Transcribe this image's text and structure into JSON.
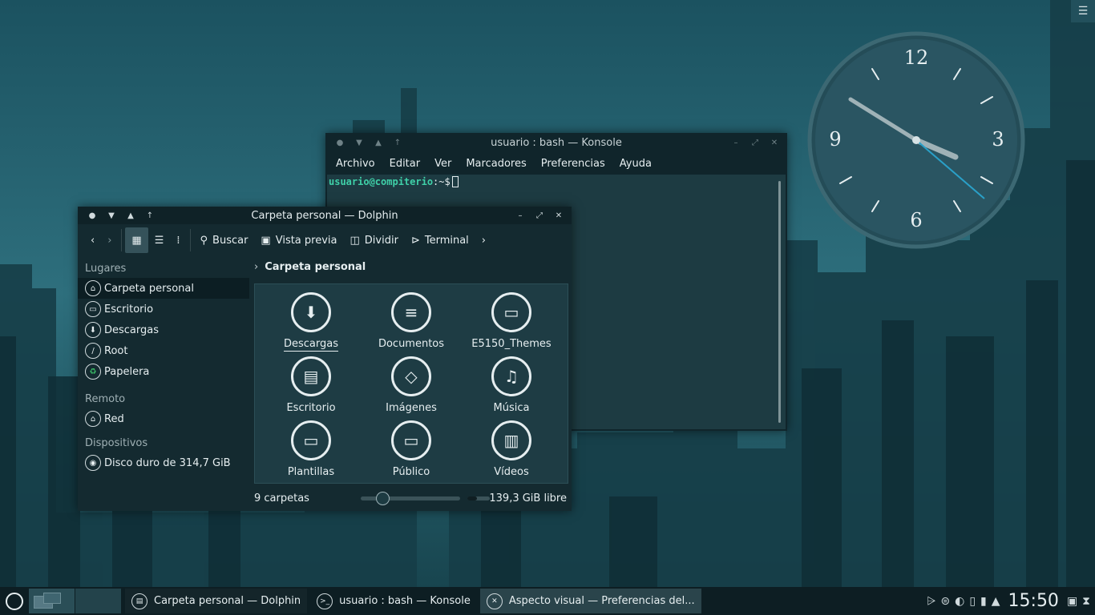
{
  "clock": {
    "n12": "12",
    "n3": "3",
    "n6": "6",
    "n9": "9"
  },
  "konsole": {
    "title": "usuario : bash — Konsole",
    "menu": [
      "Archivo",
      "Editar",
      "Ver",
      "Marcadores",
      "Preferencias",
      "Ayuda"
    ],
    "prompt_user": "usuario@compiterio",
    "prompt_path": ":~$"
  },
  "dolphin": {
    "title": "Carpeta personal — Dolphin",
    "toolbar": {
      "search": "Buscar",
      "preview": "Vista previa",
      "split": "Dividir",
      "terminal": "Terminal"
    },
    "sidebar": {
      "places_header": "Lugares",
      "places": [
        "Carpeta personal",
        "Escritorio",
        "Descargas",
        "Root",
        "Papelera"
      ],
      "remote_header": "Remoto",
      "remote": [
        "Red"
      ],
      "devices_header": "Dispositivos",
      "devices": [
        "Disco duro de 314,7 GiB"
      ]
    },
    "breadcrumb": "Carpeta personal",
    "items": [
      "Descargas",
      "Documentos",
      "E5150_Themes",
      "Escritorio",
      "Imágenes",
      "Música",
      "Plantillas",
      "Público",
      "Vídeos"
    ],
    "status_count": "9 carpetas",
    "zoom_fraction": 0.22,
    "free_space": "139,3 GiB libre"
  },
  "taskbar": {
    "tasks": [
      "Carpeta personal — Dolphin",
      "usuario : bash — Konsole",
      "Aspecto visual  — Preferencias del..."
    ],
    "time": "15:50"
  }
}
